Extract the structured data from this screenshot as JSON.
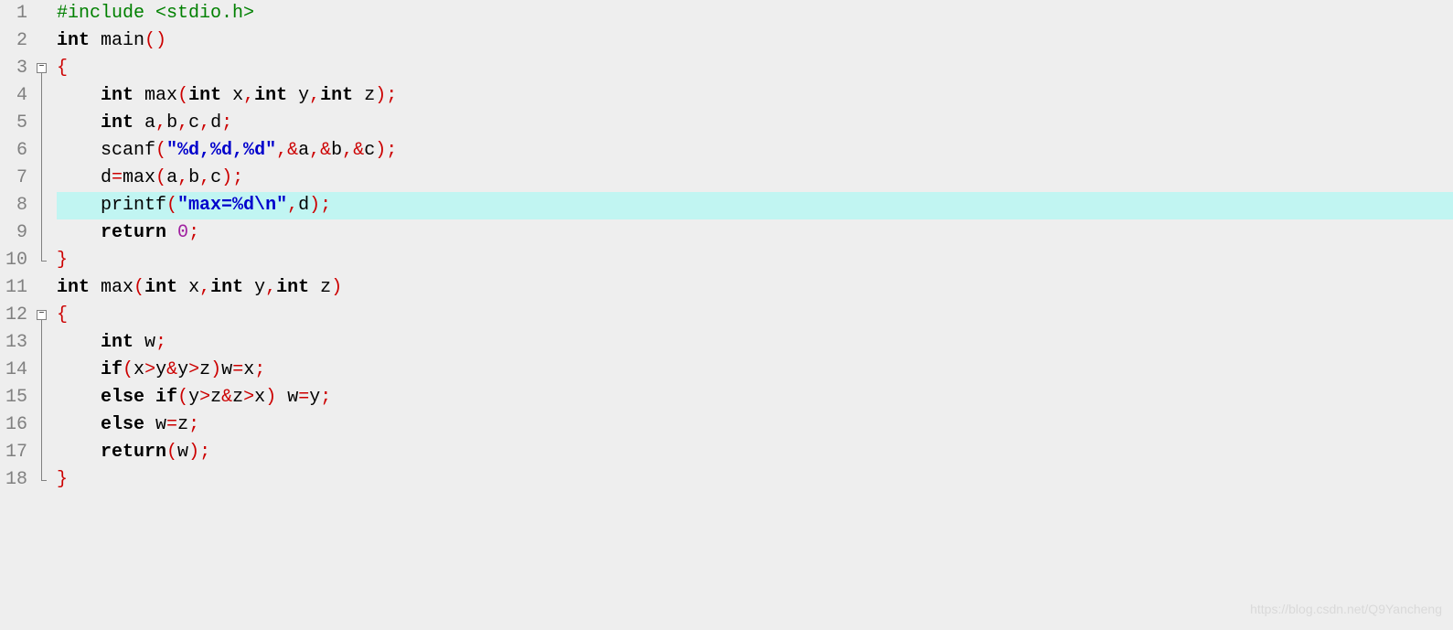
{
  "editor": {
    "highlighted_line": 8,
    "line_count": 18,
    "watermark": "https://blog.csdn.net/Q9Yancheng",
    "fold_markers": [
      {
        "line": 3,
        "end": 10
      },
      {
        "line": 12,
        "end": 18
      }
    ],
    "lines": [
      {
        "n": 1,
        "tokens": [
          {
            "t": "#include <stdio.h>",
            "c": "tok-preproc"
          }
        ]
      },
      {
        "n": 2,
        "tokens": [
          {
            "t": "int",
            "c": "tok-keyword"
          },
          {
            "t": " ",
            "c": "tok-ident"
          },
          {
            "t": "main",
            "c": "tok-ident"
          },
          {
            "t": "()",
            "c": "tok-paren"
          }
        ]
      },
      {
        "n": 3,
        "tokens": [
          {
            "t": "{",
            "c": "tok-brace"
          }
        ]
      },
      {
        "n": 4,
        "tokens": [
          {
            "t": "    ",
            "c": "tok-ident"
          },
          {
            "t": "int",
            "c": "tok-keyword"
          },
          {
            "t": " ",
            "c": "tok-ident"
          },
          {
            "t": "max",
            "c": "tok-ident"
          },
          {
            "t": "(",
            "c": "tok-paren"
          },
          {
            "t": "int",
            "c": "tok-keyword"
          },
          {
            "t": " x",
            "c": "tok-ident"
          },
          {
            "t": ",",
            "c": "tok-punct"
          },
          {
            "t": "int",
            "c": "tok-keyword"
          },
          {
            "t": " y",
            "c": "tok-ident"
          },
          {
            "t": ",",
            "c": "tok-punct"
          },
          {
            "t": "int",
            "c": "tok-keyword"
          },
          {
            "t": " z",
            "c": "tok-ident"
          },
          {
            "t": ");",
            "c": "tok-punct"
          }
        ]
      },
      {
        "n": 5,
        "tokens": [
          {
            "t": "    ",
            "c": "tok-ident"
          },
          {
            "t": "int",
            "c": "tok-keyword"
          },
          {
            "t": " a",
            "c": "tok-ident"
          },
          {
            "t": ",",
            "c": "tok-punct"
          },
          {
            "t": "b",
            "c": "tok-ident"
          },
          {
            "t": ",",
            "c": "tok-punct"
          },
          {
            "t": "c",
            "c": "tok-ident"
          },
          {
            "t": ",",
            "c": "tok-punct"
          },
          {
            "t": "d",
            "c": "tok-ident"
          },
          {
            "t": ";",
            "c": "tok-punct"
          }
        ]
      },
      {
        "n": 6,
        "tokens": [
          {
            "t": "    ",
            "c": "tok-ident"
          },
          {
            "t": "scanf",
            "c": "tok-ident"
          },
          {
            "t": "(",
            "c": "tok-paren"
          },
          {
            "t": "\"%d,%d,%d\"",
            "c": "tok-string"
          },
          {
            "t": ",",
            "c": "tok-punct"
          },
          {
            "t": "&",
            "c": "tok-amp"
          },
          {
            "t": "a",
            "c": "tok-ident"
          },
          {
            "t": ",",
            "c": "tok-punct"
          },
          {
            "t": "&",
            "c": "tok-amp"
          },
          {
            "t": "b",
            "c": "tok-ident"
          },
          {
            "t": ",",
            "c": "tok-punct"
          },
          {
            "t": "&",
            "c": "tok-amp"
          },
          {
            "t": "c",
            "c": "tok-ident"
          },
          {
            "t": ");",
            "c": "tok-punct"
          }
        ]
      },
      {
        "n": 7,
        "tokens": [
          {
            "t": "    d",
            "c": "tok-ident"
          },
          {
            "t": "=",
            "c": "tok-op"
          },
          {
            "t": "max",
            "c": "tok-ident"
          },
          {
            "t": "(",
            "c": "tok-paren"
          },
          {
            "t": "a",
            "c": "tok-ident"
          },
          {
            "t": ",",
            "c": "tok-punct"
          },
          {
            "t": "b",
            "c": "tok-ident"
          },
          {
            "t": ",",
            "c": "tok-punct"
          },
          {
            "t": "c",
            "c": "tok-ident"
          },
          {
            "t": ");",
            "c": "tok-punct"
          }
        ]
      },
      {
        "n": 8,
        "tokens": [
          {
            "t": "    ",
            "c": "tok-ident"
          },
          {
            "t": "printf",
            "c": "tok-ident"
          },
          {
            "t": "(",
            "c": "tok-paren"
          },
          {
            "t": "\"max=%d\\n\"",
            "c": "tok-string"
          },
          {
            "t": ",",
            "c": "tok-punct"
          },
          {
            "t": "d",
            "c": "tok-ident"
          },
          {
            "t": ");",
            "c": "tok-punct"
          }
        ]
      },
      {
        "n": 9,
        "tokens": [
          {
            "t": "    ",
            "c": "tok-ident"
          },
          {
            "t": "return",
            "c": "tok-keyword"
          },
          {
            "t": " ",
            "c": "tok-ident"
          },
          {
            "t": "0",
            "c": "tok-number"
          },
          {
            "t": ";",
            "c": "tok-punct"
          }
        ]
      },
      {
        "n": 10,
        "tokens": [
          {
            "t": "}",
            "c": "tok-brace"
          }
        ]
      },
      {
        "n": 11,
        "tokens": [
          {
            "t": "int",
            "c": "tok-keyword"
          },
          {
            "t": " ",
            "c": "tok-ident"
          },
          {
            "t": "max",
            "c": "tok-ident"
          },
          {
            "t": "(",
            "c": "tok-paren"
          },
          {
            "t": "int",
            "c": "tok-keyword"
          },
          {
            "t": " x",
            "c": "tok-ident"
          },
          {
            "t": ",",
            "c": "tok-punct"
          },
          {
            "t": "int",
            "c": "tok-keyword"
          },
          {
            "t": " y",
            "c": "tok-ident"
          },
          {
            "t": ",",
            "c": "tok-punct"
          },
          {
            "t": "int",
            "c": "tok-keyword"
          },
          {
            "t": " z",
            "c": "tok-ident"
          },
          {
            "t": ")",
            "c": "tok-paren"
          }
        ]
      },
      {
        "n": 12,
        "tokens": [
          {
            "t": "{",
            "c": "tok-brace"
          }
        ]
      },
      {
        "n": 13,
        "tokens": [
          {
            "t": "    ",
            "c": "tok-ident"
          },
          {
            "t": "int",
            "c": "tok-keyword"
          },
          {
            "t": " w",
            "c": "tok-ident"
          },
          {
            "t": ";",
            "c": "tok-punct"
          }
        ]
      },
      {
        "n": 14,
        "tokens": [
          {
            "t": "    ",
            "c": "tok-ident"
          },
          {
            "t": "if",
            "c": "tok-keyword"
          },
          {
            "t": "(",
            "c": "tok-paren"
          },
          {
            "t": "x",
            "c": "tok-ident"
          },
          {
            "t": ">",
            "c": "tok-op"
          },
          {
            "t": "y",
            "c": "tok-ident"
          },
          {
            "t": "&",
            "c": "tok-amp"
          },
          {
            "t": "y",
            "c": "tok-ident"
          },
          {
            "t": ">",
            "c": "tok-op"
          },
          {
            "t": "z",
            "c": "tok-ident"
          },
          {
            "t": ")",
            "c": "tok-paren"
          },
          {
            "t": "w",
            "c": "tok-ident"
          },
          {
            "t": "=",
            "c": "tok-op"
          },
          {
            "t": "x",
            "c": "tok-ident"
          },
          {
            "t": ";",
            "c": "tok-punct"
          }
        ]
      },
      {
        "n": 15,
        "tokens": [
          {
            "t": "    ",
            "c": "tok-ident"
          },
          {
            "t": "else",
            "c": "tok-keyword"
          },
          {
            "t": " ",
            "c": "tok-ident"
          },
          {
            "t": "if",
            "c": "tok-keyword"
          },
          {
            "t": "(",
            "c": "tok-paren"
          },
          {
            "t": "y",
            "c": "tok-ident"
          },
          {
            "t": ">",
            "c": "tok-op"
          },
          {
            "t": "z",
            "c": "tok-ident"
          },
          {
            "t": "&",
            "c": "tok-amp"
          },
          {
            "t": "z",
            "c": "tok-ident"
          },
          {
            "t": ">",
            "c": "tok-op"
          },
          {
            "t": "x",
            "c": "tok-ident"
          },
          {
            "t": ")",
            "c": "tok-paren"
          },
          {
            "t": " w",
            "c": "tok-ident"
          },
          {
            "t": "=",
            "c": "tok-op"
          },
          {
            "t": "y",
            "c": "tok-ident"
          },
          {
            "t": ";",
            "c": "tok-punct"
          }
        ]
      },
      {
        "n": 16,
        "tokens": [
          {
            "t": "    ",
            "c": "tok-ident"
          },
          {
            "t": "else",
            "c": "tok-keyword"
          },
          {
            "t": " w",
            "c": "tok-ident"
          },
          {
            "t": "=",
            "c": "tok-op"
          },
          {
            "t": "z",
            "c": "tok-ident"
          },
          {
            "t": ";",
            "c": "tok-punct"
          }
        ]
      },
      {
        "n": 17,
        "tokens": [
          {
            "t": "    ",
            "c": "tok-ident"
          },
          {
            "t": "return",
            "c": "tok-keyword"
          },
          {
            "t": "(",
            "c": "tok-paren"
          },
          {
            "t": "w",
            "c": "tok-ident"
          },
          {
            "t": ");",
            "c": "tok-punct"
          }
        ]
      },
      {
        "n": 18,
        "tokens": [
          {
            "t": "}",
            "c": "tok-brace"
          }
        ]
      }
    ]
  }
}
